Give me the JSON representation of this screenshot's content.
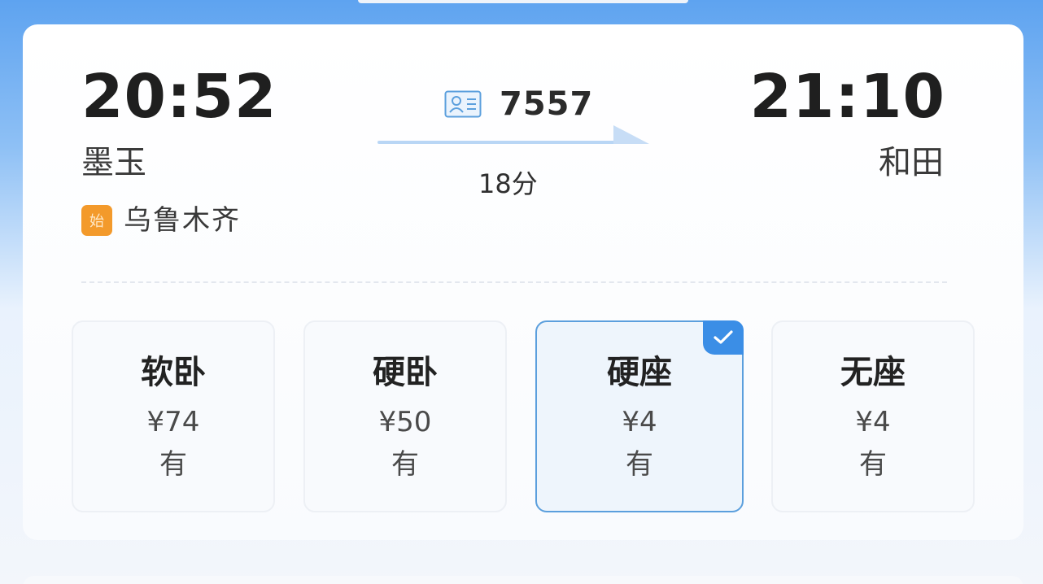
{
  "departure": {
    "time": "20:52",
    "station": "墨玉",
    "origin_badge": "始",
    "origin_station": "乌鲁木齐"
  },
  "arrival": {
    "time": "21:10",
    "station": "和田"
  },
  "train": {
    "number": "7557",
    "duration": "18分",
    "icon": "id-card-icon"
  },
  "seats": [
    {
      "name": "软卧",
      "price": "¥74",
      "availability": "有",
      "selected": false
    },
    {
      "name": "硬卧",
      "price": "¥50",
      "availability": "有",
      "selected": false
    },
    {
      "name": "硬座",
      "price": "¥4",
      "availability": "有",
      "selected": true
    },
    {
      "name": "无座",
      "price": "¥4",
      "availability": "有",
      "selected": false
    }
  ],
  "colors": {
    "accent": "#3b8ee6",
    "origin_badge": "#f39a2b",
    "arrow": "#b9d6f5"
  }
}
